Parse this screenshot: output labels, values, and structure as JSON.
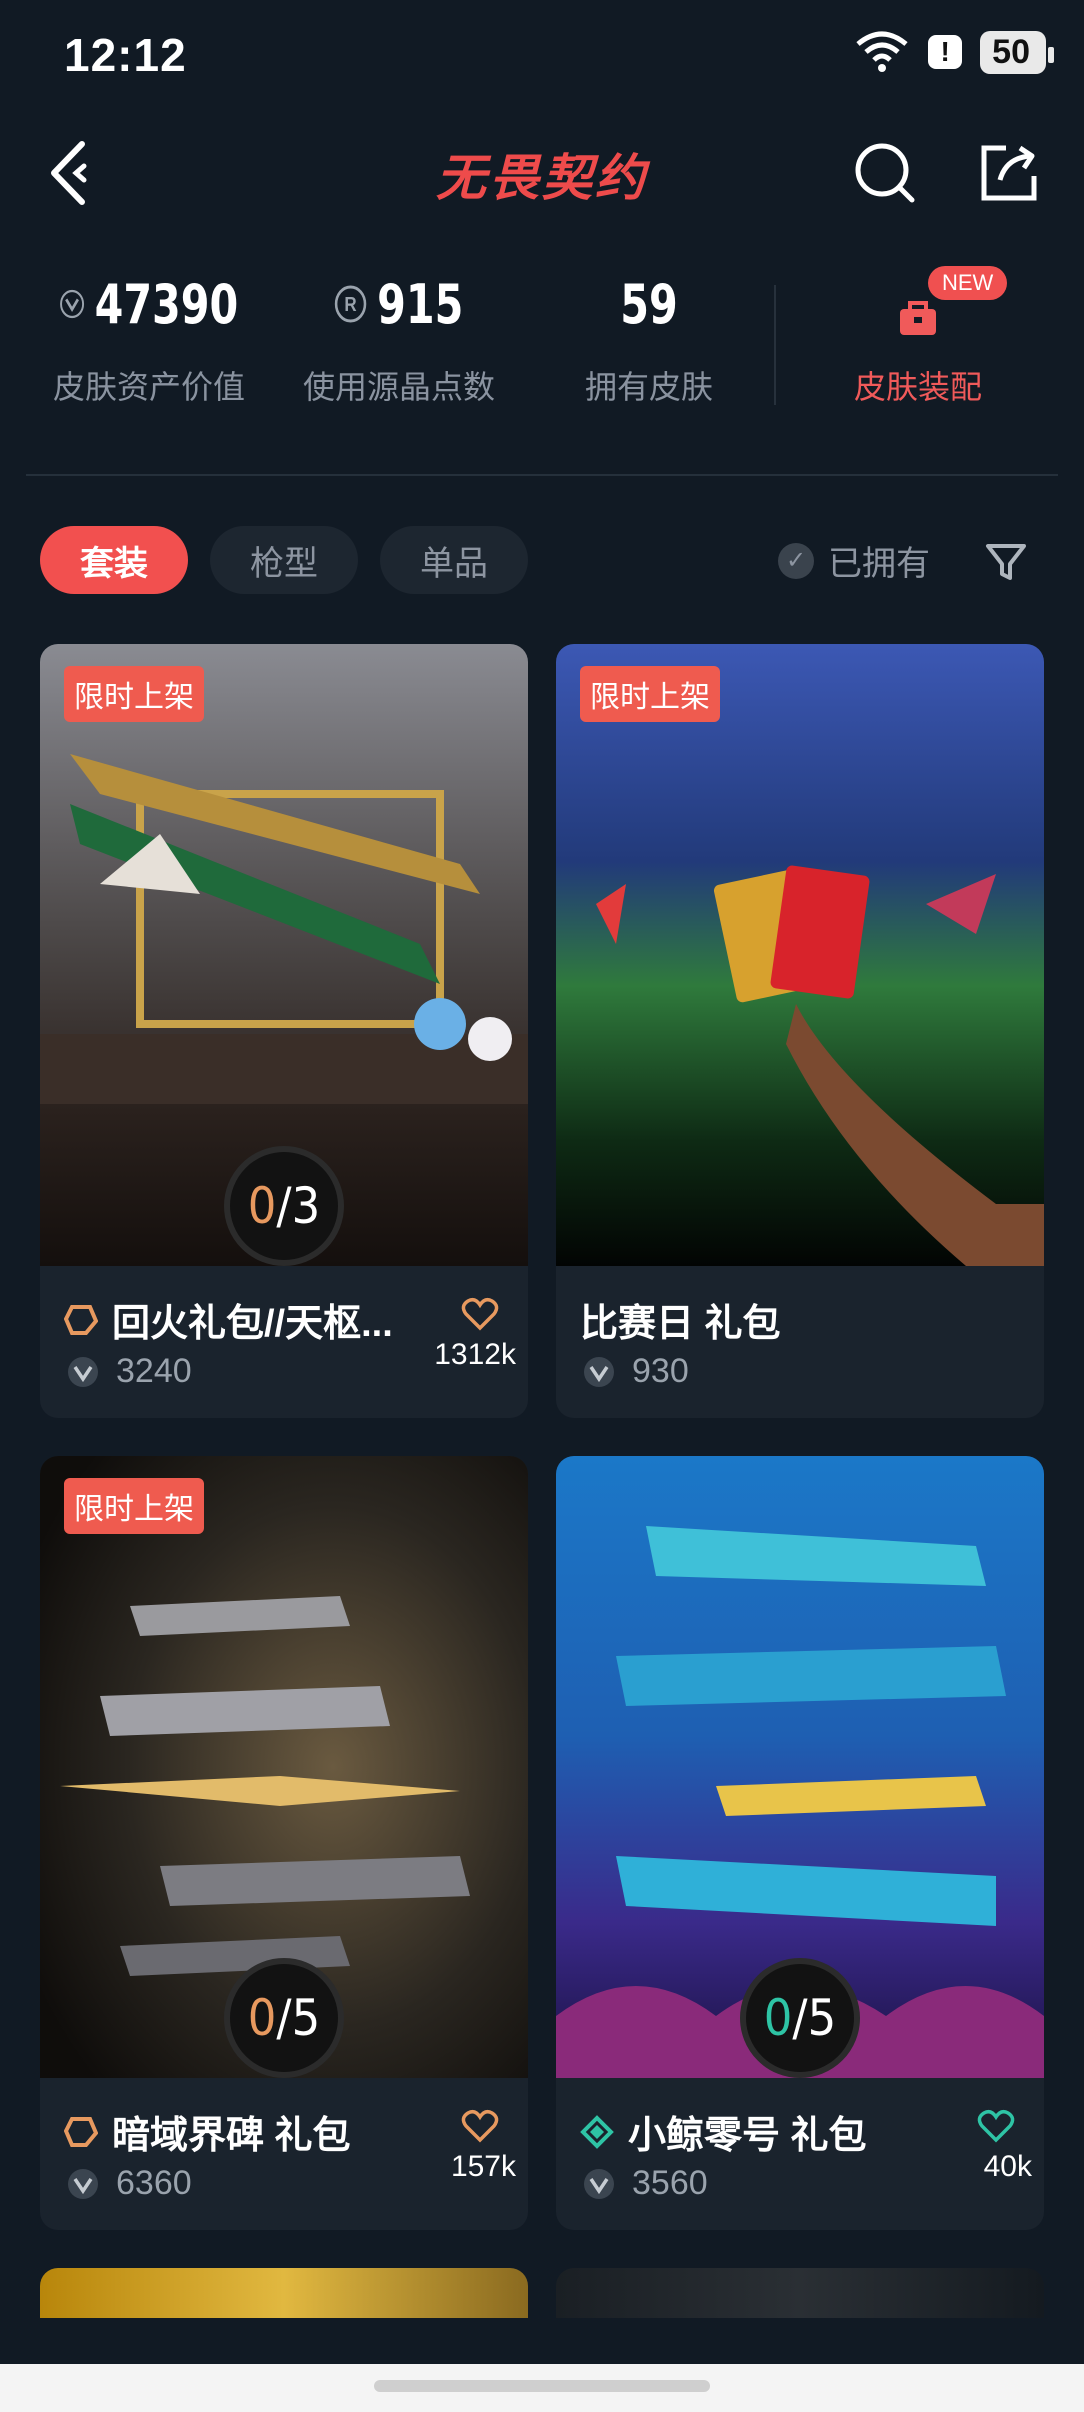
{
  "status": {
    "time": "12:12",
    "battery": "50",
    "signal": "6"
  },
  "nav": {
    "title": "无畏契约"
  },
  "stats": [
    {
      "value": "47390",
      "label": "皮肤资产价值",
      "icon": "vp-icon"
    },
    {
      "value": "915",
      "label": "使用源晶点数",
      "icon": "radianite-icon"
    },
    {
      "value": "59",
      "label": "拥有皮肤"
    }
  ],
  "kit": {
    "label": "皮肤装配",
    "badge": "NEW"
  },
  "tabs": [
    "套装",
    "枪型",
    "单品"
  ],
  "filter": {
    "owned_label": "已拥有"
  },
  "cards": [
    {
      "badge": "限时上架",
      "owned": "0",
      "total": "3",
      "name": "回火礼包//天枢...",
      "price": "3240",
      "likes": "1312k",
      "tier": "deluxe"
    },
    {
      "badge": "限时上架",
      "name": "比赛日 礼包",
      "price": "930"
    },
    {
      "badge": "限时上架",
      "owned": "0",
      "total": "5",
      "name": "暗域界碑 礼包",
      "price": "6360",
      "likes": "157k",
      "tier": "deluxe"
    },
    {
      "owned": "0",
      "total": "5",
      "name": "小鲸零号 礼包",
      "price": "3560",
      "likes": "40k",
      "tier": "select"
    }
  ],
  "colors": {
    "accent": "#f2504f",
    "background": "#111a24",
    "deluxe": "#e7995f",
    "select": "#2ec4a5"
  }
}
